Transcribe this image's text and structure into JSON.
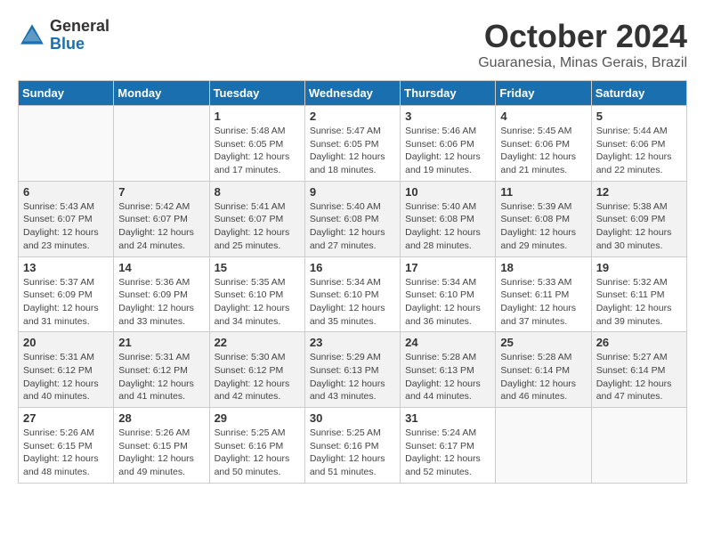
{
  "header": {
    "logo_general": "General",
    "logo_blue": "Blue",
    "month": "October 2024",
    "location": "Guaranesia, Minas Gerais, Brazil"
  },
  "weekdays": [
    "Sunday",
    "Monday",
    "Tuesday",
    "Wednesday",
    "Thursday",
    "Friday",
    "Saturday"
  ],
  "weeks": [
    [
      {
        "day": "",
        "info": ""
      },
      {
        "day": "",
        "info": ""
      },
      {
        "day": "1",
        "info": "Sunrise: 5:48 AM\nSunset: 6:05 PM\nDaylight: 12 hours\nand 17 minutes."
      },
      {
        "day": "2",
        "info": "Sunrise: 5:47 AM\nSunset: 6:05 PM\nDaylight: 12 hours\nand 18 minutes."
      },
      {
        "day": "3",
        "info": "Sunrise: 5:46 AM\nSunset: 6:06 PM\nDaylight: 12 hours\nand 19 minutes."
      },
      {
        "day": "4",
        "info": "Sunrise: 5:45 AM\nSunset: 6:06 PM\nDaylight: 12 hours\nand 21 minutes."
      },
      {
        "day": "5",
        "info": "Sunrise: 5:44 AM\nSunset: 6:06 PM\nDaylight: 12 hours\nand 22 minutes."
      }
    ],
    [
      {
        "day": "6",
        "info": "Sunrise: 5:43 AM\nSunset: 6:07 PM\nDaylight: 12 hours\nand 23 minutes."
      },
      {
        "day": "7",
        "info": "Sunrise: 5:42 AM\nSunset: 6:07 PM\nDaylight: 12 hours\nand 24 minutes."
      },
      {
        "day": "8",
        "info": "Sunrise: 5:41 AM\nSunset: 6:07 PM\nDaylight: 12 hours\nand 25 minutes."
      },
      {
        "day": "9",
        "info": "Sunrise: 5:40 AM\nSunset: 6:08 PM\nDaylight: 12 hours\nand 27 minutes."
      },
      {
        "day": "10",
        "info": "Sunrise: 5:40 AM\nSunset: 6:08 PM\nDaylight: 12 hours\nand 28 minutes."
      },
      {
        "day": "11",
        "info": "Sunrise: 5:39 AM\nSunset: 6:08 PM\nDaylight: 12 hours\nand 29 minutes."
      },
      {
        "day": "12",
        "info": "Sunrise: 5:38 AM\nSunset: 6:09 PM\nDaylight: 12 hours\nand 30 minutes."
      }
    ],
    [
      {
        "day": "13",
        "info": "Sunrise: 5:37 AM\nSunset: 6:09 PM\nDaylight: 12 hours\nand 31 minutes."
      },
      {
        "day": "14",
        "info": "Sunrise: 5:36 AM\nSunset: 6:09 PM\nDaylight: 12 hours\nand 33 minutes."
      },
      {
        "day": "15",
        "info": "Sunrise: 5:35 AM\nSunset: 6:10 PM\nDaylight: 12 hours\nand 34 minutes."
      },
      {
        "day": "16",
        "info": "Sunrise: 5:34 AM\nSunset: 6:10 PM\nDaylight: 12 hours\nand 35 minutes."
      },
      {
        "day": "17",
        "info": "Sunrise: 5:34 AM\nSunset: 6:10 PM\nDaylight: 12 hours\nand 36 minutes."
      },
      {
        "day": "18",
        "info": "Sunrise: 5:33 AM\nSunset: 6:11 PM\nDaylight: 12 hours\nand 37 minutes."
      },
      {
        "day": "19",
        "info": "Sunrise: 5:32 AM\nSunset: 6:11 PM\nDaylight: 12 hours\nand 39 minutes."
      }
    ],
    [
      {
        "day": "20",
        "info": "Sunrise: 5:31 AM\nSunset: 6:12 PM\nDaylight: 12 hours\nand 40 minutes."
      },
      {
        "day": "21",
        "info": "Sunrise: 5:31 AM\nSunset: 6:12 PM\nDaylight: 12 hours\nand 41 minutes."
      },
      {
        "day": "22",
        "info": "Sunrise: 5:30 AM\nSunset: 6:12 PM\nDaylight: 12 hours\nand 42 minutes."
      },
      {
        "day": "23",
        "info": "Sunrise: 5:29 AM\nSunset: 6:13 PM\nDaylight: 12 hours\nand 43 minutes."
      },
      {
        "day": "24",
        "info": "Sunrise: 5:28 AM\nSunset: 6:13 PM\nDaylight: 12 hours\nand 44 minutes."
      },
      {
        "day": "25",
        "info": "Sunrise: 5:28 AM\nSunset: 6:14 PM\nDaylight: 12 hours\nand 46 minutes."
      },
      {
        "day": "26",
        "info": "Sunrise: 5:27 AM\nSunset: 6:14 PM\nDaylight: 12 hours\nand 47 minutes."
      }
    ],
    [
      {
        "day": "27",
        "info": "Sunrise: 5:26 AM\nSunset: 6:15 PM\nDaylight: 12 hours\nand 48 minutes."
      },
      {
        "day": "28",
        "info": "Sunrise: 5:26 AM\nSunset: 6:15 PM\nDaylight: 12 hours\nand 49 minutes."
      },
      {
        "day": "29",
        "info": "Sunrise: 5:25 AM\nSunset: 6:16 PM\nDaylight: 12 hours\nand 50 minutes."
      },
      {
        "day": "30",
        "info": "Sunrise: 5:25 AM\nSunset: 6:16 PM\nDaylight: 12 hours\nand 51 minutes."
      },
      {
        "day": "31",
        "info": "Sunrise: 5:24 AM\nSunset: 6:17 PM\nDaylight: 12 hours\nand 52 minutes."
      },
      {
        "day": "",
        "info": ""
      },
      {
        "day": "",
        "info": ""
      }
    ]
  ]
}
